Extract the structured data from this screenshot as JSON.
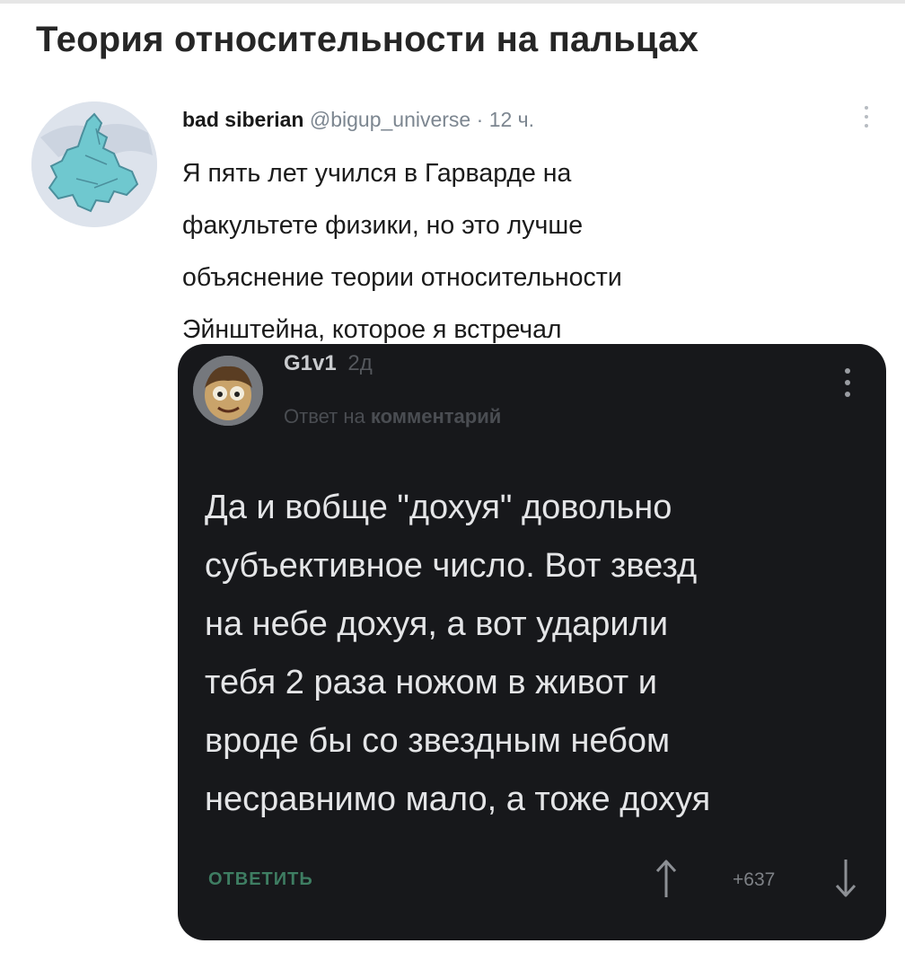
{
  "page": {
    "title": "Теория относительности на пальцах"
  },
  "tweet": {
    "author_name": "bad siberian",
    "author_handle": "@bigup_universe",
    "separator": "·",
    "time": "12 ч.",
    "text_lines": [
      "Я пять лет учился в Гарварде на",
      "факультете физики, но это лучше",
      "объяснение теории относительности",
      "Эйнштейна, которое я встречал"
    ],
    "avatar_icon": "siberia-map-icon",
    "more_icon": "more-vertical-icon"
  },
  "embedded_comment": {
    "username": "G1v1",
    "age": "2д",
    "reply_prefix": "Ответ на",
    "reply_target": "комментарий",
    "body_lines": [
      "Да и вобще \"дохуя\" довольно",
      "субъективное число. Вот звезд",
      "на небе дохуя, а вот ударили",
      "тебя 2 раза ножом в живот и",
      "вроде бы со звездным небом",
      "несравнимо мало, а тоже дохуя"
    ],
    "reply_button": "ОТВЕТИТЬ",
    "score": "+637",
    "colors": {
      "card_background": "#17181b",
      "reply_accent": "#3e7d62"
    }
  }
}
